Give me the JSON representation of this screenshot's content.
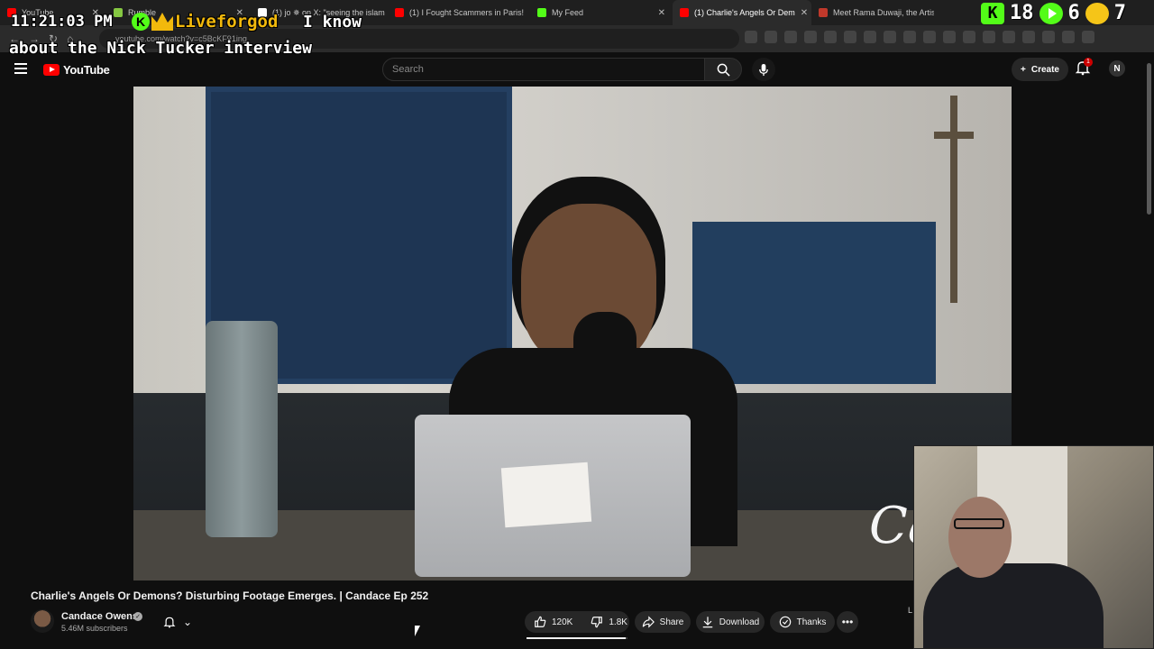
{
  "browser": {
    "tabs": [
      {
        "label": "YouTube",
        "favicon_color": "#ff0000",
        "closable": true
      },
      {
        "label": "Rumble",
        "favicon_color": "#85c742",
        "closable": true
      },
      {
        "label": "(1) ‎j‎o ✵ on X: \"seeing the islam",
        "favicon_color": "#ffffff",
        "closable": true
      },
      {
        "label": "(1) I Fought Scammers in Paris!",
        "favicon_color": "#ff0000",
        "closable": true
      },
      {
        "label": "My Feed",
        "favicon_color": "#53fc18",
        "closable": true
      },
      {
        "label": "(1) Charlie's Angels Or Dem",
        "favicon_color": "#ff0000",
        "closable": true,
        "active": true
      },
      {
        "label": "Meet Rama Duwaji, the Artist",
        "favicon_color": "#c0392b",
        "closable": false
      }
    ],
    "url": "youtube.com/watch?v=c5BcKF91ing"
  },
  "overlay": {
    "clock": "11:21:03 PM",
    "badge_letter": "K",
    "username": "Liveforgod",
    "message_line1": "I know",
    "message_line2": "about the Nick Tucker interview",
    "stat_kick_letter": "K",
    "stat_kick": "18",
    "stat_rumble": "6",
    "stat_third": "7"
  },
  "masthead": {
    "logo_text": "YouTube",
    "search_placeholder": "Search",
    "create_label": "Create",
    "notification_count": "1",
    "avatar_letter": "N"
  },
  "video": {
    "title": "Charlie's Angels Or Demons? Disturbing Footage Emerges. | Candace Ep 252",
    "watermark_text": "Car",
    "channel_name": "Candace Owens",
    "subscribers": "5.46M subscribers",
    "likes": "120K",
    "dislikes": "1.8K",
    "like_ratio": 0.985,
    "share_label": "Share",
    "download_label": "Download",
    "thanks_label": "Thanks",
    "side_letter": "L"
  },
  "colors": {
    "brand_red": "#ff0000",
    "kick_green": "#53fc18",
    "username_gold": "#f2b90c",
    "background": "#0f0f0f"
  },
  "icons": {
    "back": "arrow-left-icon",
    "reload": "reload-icon",
    "menu": "hamburger-icon",
    "search": "search-icon",
    "mic": "microphone-icon",
    "bell": "bell-icon",
    "like": "thumbs-up-icon",
    "dislike": "thumbs-down-icon",
    "share": "share-arrow-icon",
    "download": "download-icon",
    "thanks": "thanks-icon",
    "more": "more-horizontal-icon"
  }
}
